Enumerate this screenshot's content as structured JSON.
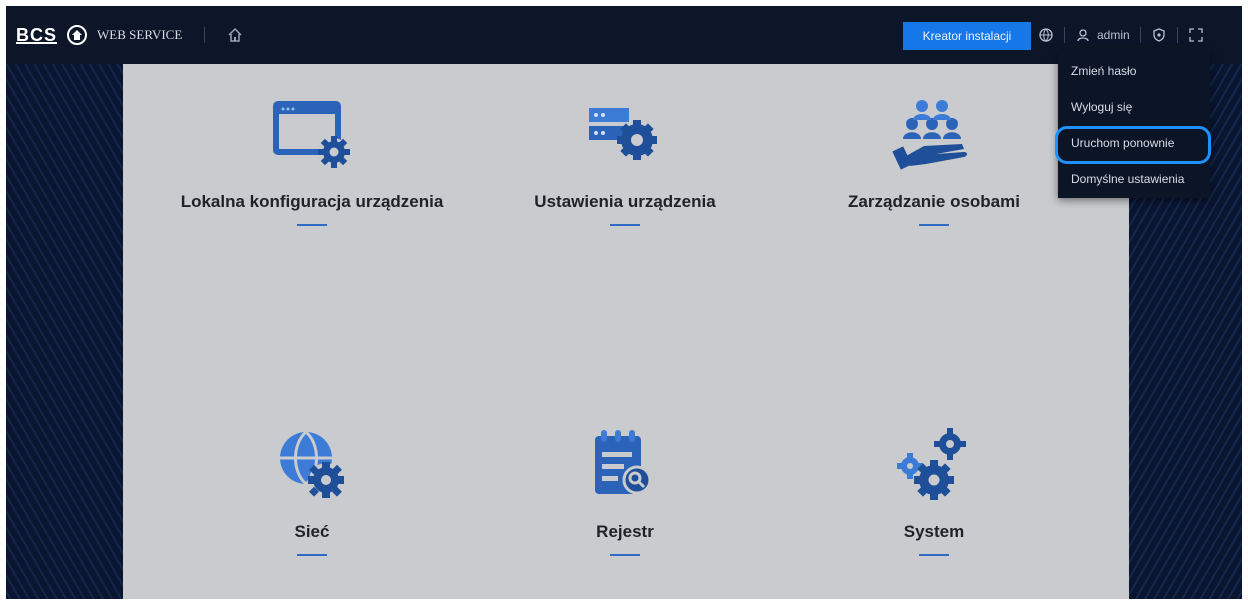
{
  "header": {
    "logo": "BCS",
    "app_title": "WEB SERVICE",
    "wizard_button": "Kreator instalacji",
    "user": "admin"
  },
  "tiles": [
    {
      "label": "Lokalna konfiguracja urządzenia",
      "icon": "monitor-gear-icon"
    },
    {
      "label": "Ustawienia urządzenia",
      "icon": "server-gear-icon"
    },
    {
      "label": "Zarządzanie osobami",
      "icon": "people-hand-icon"
    },
    {
      "label": "Sieć",
      "icon": "globe-gear-icon"
    },
    {
      "label": "Rejestr",
      "icon": "log-search-icon"
    },
    {
      "label": "System",
      "icon": "gears-icon"
    }
  ],
  "user_menu": {
    "items": [
      "Zmień hasło",
      "Wyloguj się",
      "Uruchom ponownie",
      "Domyślne ustawienia"
    ],
    "highlighted": "Uruchom ponownie"
  },
  "colors": {
    "accent": "#1677e8",
    "highlight": "#1e90ff",
    "icon_blue": "#2a63b8",
    "panel": "#c9cbce",
    "topbar": "#0d1628"
  }
}
